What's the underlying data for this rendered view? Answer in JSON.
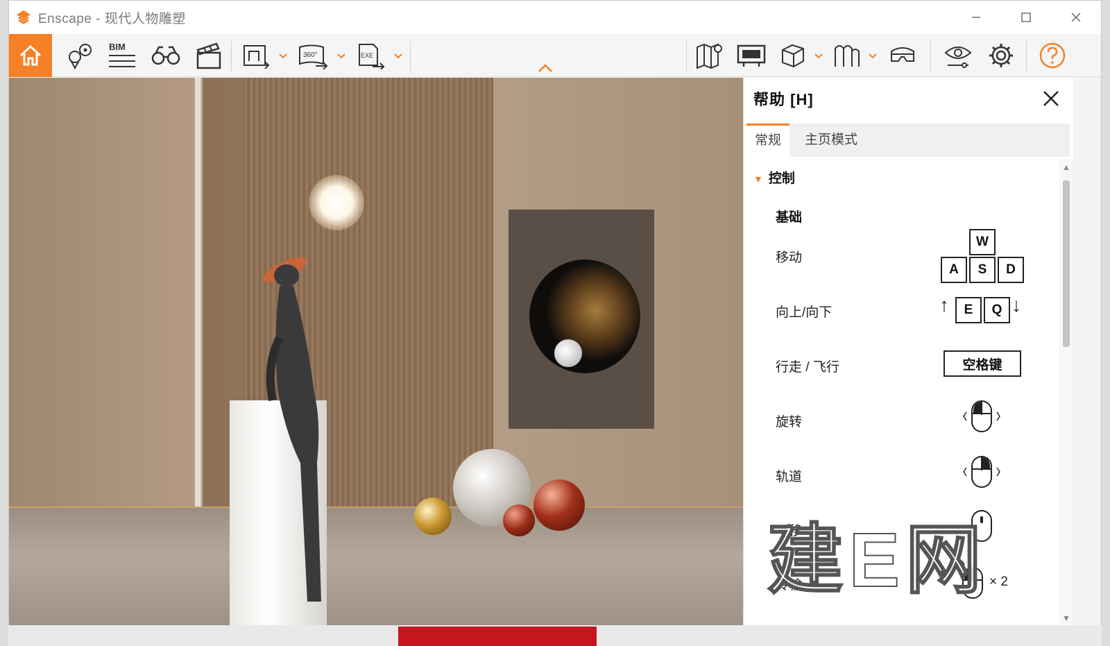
{
  "window": {
    "title": "Enscape - 现代人物雕塑",
    "controls": [
      "minimize",
      "maximize",
      "close"
    ]
  },
  "toolbar": {
    "bim_label": "BIM",
    "panorama_label": "360°",
    "exe_label": "EXE",
    "left_buttons": [
      {
        "name": "home",
        "icon": "home-icon"
      },
      {
        "name": "views",
        "icon": "location-pins-icon"
      },
      {
        "name": "bim",
        "icon": "bim-icon"
      },
      {
        "name": "visual-settings",
        "icon": "binoculars-icon"
      },
      {
        "name": "video-editor",
        "icon": "clapperboard-icon"
      },
      {
        "name": "render-export",
        "icon": "render-export-icon"
      },
      {
        "name": "panorama-export",
        "icon": "panorama-export-icon"
      },
      {
        "name": "exe-export",
        "icon": "exe-export-icon"
      }
    ],
    "right_buttons": [
      {
        "name": "map",
        "icon": "map-icon"
      },
      {
        "name": "billboard",
        "icon": "billboard-icon"
      },
      {
        "name": "cube",
        "icon": "cube-icon"
      },
      {
        "name": "asset-library",
        "icon": "asset-library-icon"
      },
      {
        "name": "vr-headset",
        "icon": "vr-headset-icon"
      },
      {
        "name": "view-mode",
        "icon": "eye-icon"
      },
      {
        "name": "settings",
        "icon": "gear-icon"
      },
      {
        "name": "help",
        "icon": "help-icon"
      }
    ]
  },
  "help_panel": {
    "title": "帮助 [H]",
    "tabs": [
      {
        "label": "常规",
        "active": true
      },
      {
        "label": "主页模式",
        "active": false
      }
    ],
    "section": "控制",
    "subsection": "基础",
    "controls": [
      {
        "label": "移动",
        "keys": [
          "W",
          "A",
          "S",
          "D"
        ]
      },
      {
        "label": "向上/向下",
        "keys": [
          "E",
          "Q"
        ]
      },
      {
        "label": "行走 / 飞行",
        "key": "空格键"
      },
      {
        "label": "旋转",
        "mouse": "left-button"
      },
      {
        "label": "轨道",
        "mouse": "right-button"
      },
      {
        "label": "平移",
        "mouse": "middle-button"
      },
      {
        "label": "传输",
        "mouse": "double-click",
        "count": "× 2"
      }
    ]
  },
  "watermark": "建E网",
  "colors": {
    "accent": "#f58025",
    "panel_bg": "#ffffff",
    "toolbar_bg": "#f5f5f5"
  }
}
